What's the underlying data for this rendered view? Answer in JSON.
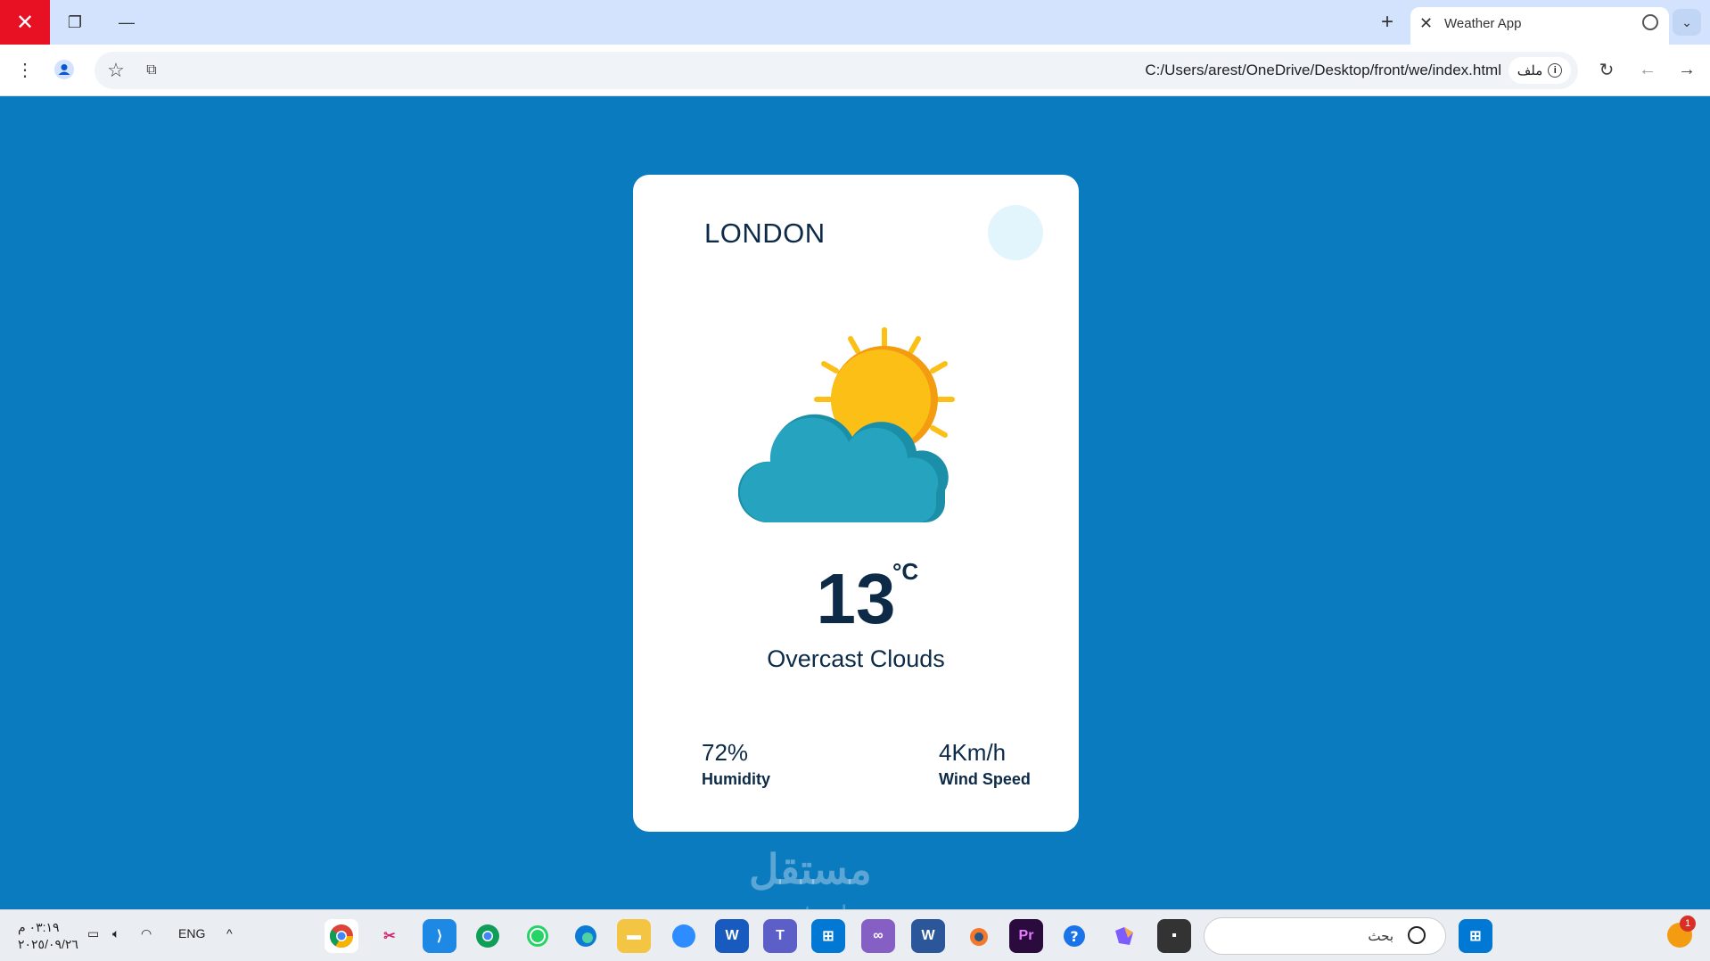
{
  "browser": {
    "tab_title": "Weather App",
    "url": "C:/Users/arest/OneDrive/Desktop/front/we/index.html",
    "site_chip": "ملف"
  },
  "weather": {
    "city": "LONDON",
    "temperature": "13",
    "unit": "°C",
    "description": "Overcast Clouds",
    "humidity_value": "72%",
    "humidity_label": "Humidity",
    "wind_value": "4Km/h",
    "wind_label": "Wind Speed",
    "icon": "sun-behind-cloud-icon"
  },
  "watermark": {
    "text": "مستقل",
    "subtext": "mostaql.com"
  },
  "taskbar": {
    "time": "٠٣:١٩ م",
    "date": "٢٠٢٥/٠٩/٢٦",
    "language": "ENG",
    "search_text": "بحث",
    "notification_count": "1"
  },
  "colors": {
    "page_background": "#0b7bc0",
    "card": "#ffffff",
    "text": "#0d2a47",
    "sun": "#fbbf16",
    "cloud": "#24a0bb"
  }
}
